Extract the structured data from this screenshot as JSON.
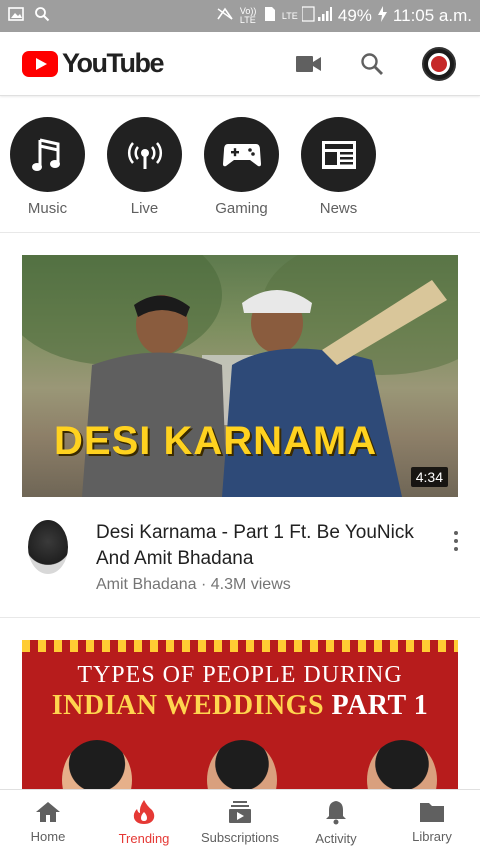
{
  "status_bar": {
    "battery": "49%",
    "time": "11:05 a.m.",
    "network_labels": [
      "Vo)) LTE",
      "LTE"
    ]
  },
  "header": {
    "logo_text": "YouTube",
    "icons": [
      "video-camera-icon",
      "search-icon",
      "account-avatar"
    ]
  },
  "categories": [
    {
      "label": "Music",
      "icon": "music-note-icon"
    },
    {
      "label": "Live",
      "icon": "live-broadcast-icon"
    },
    {
      "label": "Gaming",
      "icon": "gamepad-icon"
    },
    {
      "label": "News",
      "icon": "newspaper-icon"
    }
  ],
  "videos": [
    {
      "thumbnail_text": "DESI KARNAMA",
      "duration": "4:34",
      "title": "Desi Karnama - Part 1 Ft. Be YouNick And Amit Bhadana",
      "subtitle": "Amit Bhadana · 4.3M views"
    },
    {
      "thumbnail_line1": "TYPES OF PEOPLE DURING",
      "thumbnail_line2a": "INDIAN WEDDINGS",
      "thumbnail_line2b": "PART 1"
    }
  ],
  "bottom_nav": [
    {
      "label": "Home",
      "icon": "home-icon",
      "active": false
    },
    {
      "label": "Trending",
      "icon": "flame-icon",
      "active": true
    },
    {
      "label": "Subscriptions",
      "icon": "subscriptions-icon",
      "active": false
    },
    {
      "label": "Activity",
      "icon": "bell-icon",
      "active": false
    },
    {
      "label": "Library",
      "icon": "folder-icon",
      "active": false
    }
  ],
  "colors": {
    "brand_red": "#ff0000",
    "active_nav": "#e53935",
    "category_circle": "#212121"
  }
}
